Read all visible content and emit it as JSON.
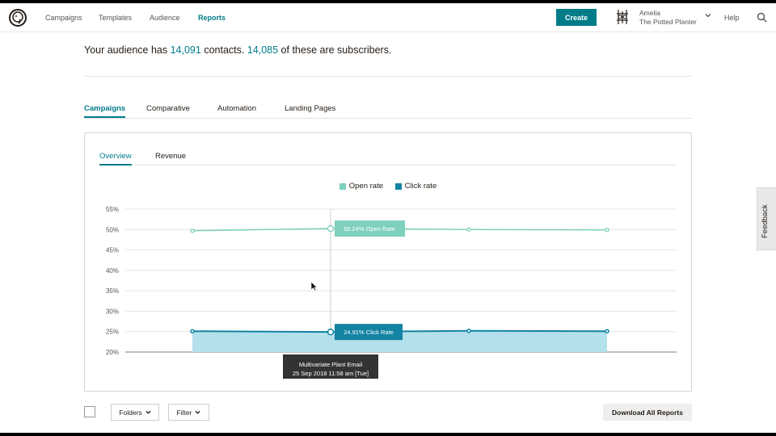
{
  "nav": {
    "items": [
      {
        "label": "Campaigns",
        "active": false
      },
      {
        "label": "Templates",
        "active": false
      },
      {
        "label": "Audience",
        "active": false
      },
      {
        "label": "Reports",
        "active": true
      }
    ],
    "create_label": "Create",
    "account": {
      "user": "Amelia",
      "org": "The Potted Planter"
    },
    "help_label": "Help",
    "icons": {
      "logo": "freddie-logo-icon",
      "account": "account-logo-icon",
      "chevron": "chevron-down-icon",
      "search": "search-icon"
    }
  },
  "summary": {
    "prefix": "Your audience has",
    "contacts": "14,091",
    "middle": "contacts.",
    "subscribers": "14,085",
    "suffix": "of these are subscribers."
  },
  "tabs": [
    {
      "label": "Campaigns",
      "active": true
    },
    {
      "label": "Comparative",
      "active": false
    },
    {
      "label": "Automation",
      "active": false
    },
    {
      "label": "Landing Pages",
      "active": false
    }
  ],
  "subtabs": [
    {
      "label": "Overview",
      "active": true
    },
    {
      "label": "Revenue",
      "active": false
    }
  ],
  "chart_data": {
    "type": "line",
    "title": "",
    "xlabel": "",
    "ylabel": "",
    "ylim": [
      20,
      55
    ],
    "yticks": [
      "20%",
      "25%",
      "30%",
      "35%",
      "40%",
      "45%",
      "50%",
      "55%"
    ],
    "grid": true,
    "legend": "top-center",
    "x": [
      1,
      2,
      3,
      4
    ],
    "series": [
      {
        "name": "Open rate",
        "color": "#7fd0bd",
        "values": [
          49.7,
          50.24,
          50.0,
          49.9
        ]
      },
      {
        "name": "Click rate",
        "color": "#1383a3",
        "fill": "#b3e0ea",
        "values": [
          25.1,
          24.91,
          25.2,
          25.1
        ]
      }
    ],
    "annotations": {
      "open_label": "50.24% Open Rate",
      "click_label": "24.91% Click Rate",
      "highlight_index": 1
    }
  },
  "tooltip": {
    "title": "Multivariate Plant Email",
    "date": "25 Sep 2018 11:58 am [Tue]"
  },
  "controls": {
    "folders_label": "Folders",
    "filter_label": "Filter",
    "download_label": "Download All Reports"
  },
  "feedback_label": "Feedback"
}
